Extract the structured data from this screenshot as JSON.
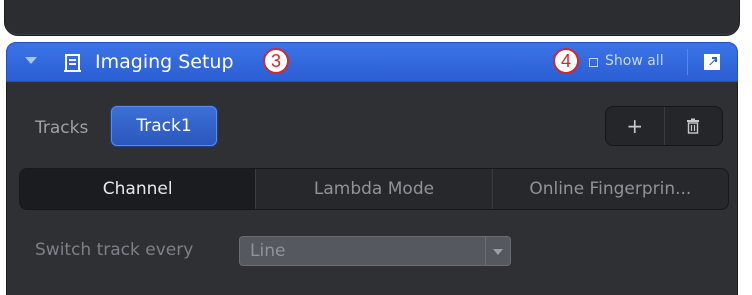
{
  "header": {
    "title": "Imaging Setup",
    "show_all_label": "Show all",
    "annotation_3": "3",
    "annotation_4": "4"
  },
  "tracks": {
    "label": "Tracks",
    "items": [
      {
        "label": "Track1"
      }
    ],
    "add_symbol": "+",
    "delete_icon": "trash-icon"
  },
  "tabs": [
    {
      "label": "Channel",
      "active": true
    },
    {
      "label": "Lambda Mode",
      "active": false
    },
    {
      "label": "Online Fingerprin...",
      "active": false
    }
  ],
  "switch_track": {
    "label": "Switch track every",
    "selected": "Line"
  },
  "colors": {
    "header_blue": "#3b73e6",
    "panel_bg": "#2e3034",
    "annotation_red": "#d6262c"
  }
}
